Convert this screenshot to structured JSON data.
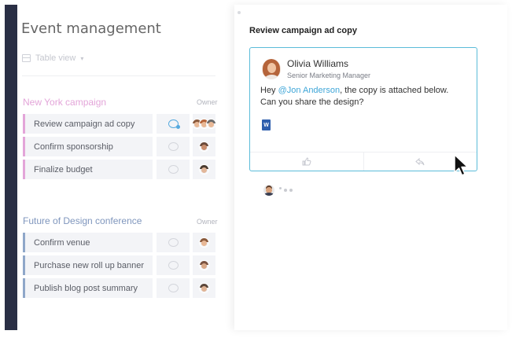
{
  "board": {
    "title": "Event management",
    "view_label": "Table view",
    "owner_header": "Owner"
  },
  "groups": [
    {
      "title": "New York campaign",
      "color": "#e3a5d9",
      "tasks": [
        {
          "label": "Review campaign ad copy"
        },
        {
          "label": "Confirm sponsorship"
        },
        {
          "label": "Finalize budget"
        }
      ]
    },
    {
      "title": "Future of Design conference",
      "color": "#8fa7c9",
      "tasks": [
        {
          "label": "Confirm venue"
        },
        {
          "label": "Purchase new roll up banner"
        },
        {
          "label": "Publish blog post summary"
        }
      ]
    }
  ],
  "panel": {
    "title": "Review campaign ad copy",
    "comment": {
      "author": "Olivia Williams",
      "role": "Senior Marketing Manager",
      "greeting": "Hey ",
      "mention": "@Jon Anderson",
      "text_after": ", the copy is attached below.",
      "line2": "Can you share the design?",
      "attachment_icon": "word-doc-icon",
      "attachment_letter": "W"
    },
    "actions": [
      "thumbs-up-icon",
      "reply-icon"
    ]
  },
  "colors": {
    "sidebar": "#2a2f45",
    "accent": "#5bbcd9",
    "mention": "#3fa6d8"
  }
}
